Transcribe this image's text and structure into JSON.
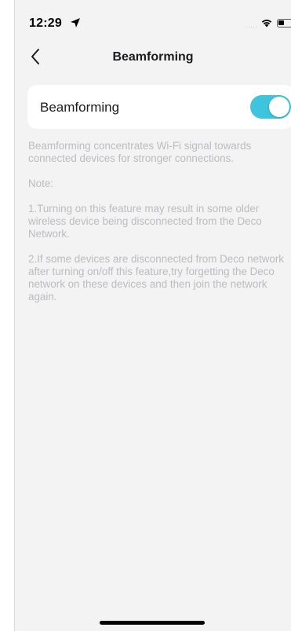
{
  "status_bar": {
    "time": "12:29",
    "signal_dots": "....."
  },
  "nav": {
    "title": "Beamforming",
    "back_icon": "chevron-left-icon"
  },
  "setting": {
    "label": "Beamforming",
    "toggle_on": true,
    "toggle_color": "#3ec4dc"
  },
  "description": {
    "intro": "Beamforming concentrates Wi-Fi signal towards connected devices for stronger connections.",
    "note_heading": "Note:",
    "note_1": "1.Turning on this feature may result in some older wireless device being disconnected from the Deco Network.",
    "note_2": "2.If some devices are disconnected from Deco network after turning on/off this feature,try forgetting the Deco network on these devices and then join the network again."
  }
}
